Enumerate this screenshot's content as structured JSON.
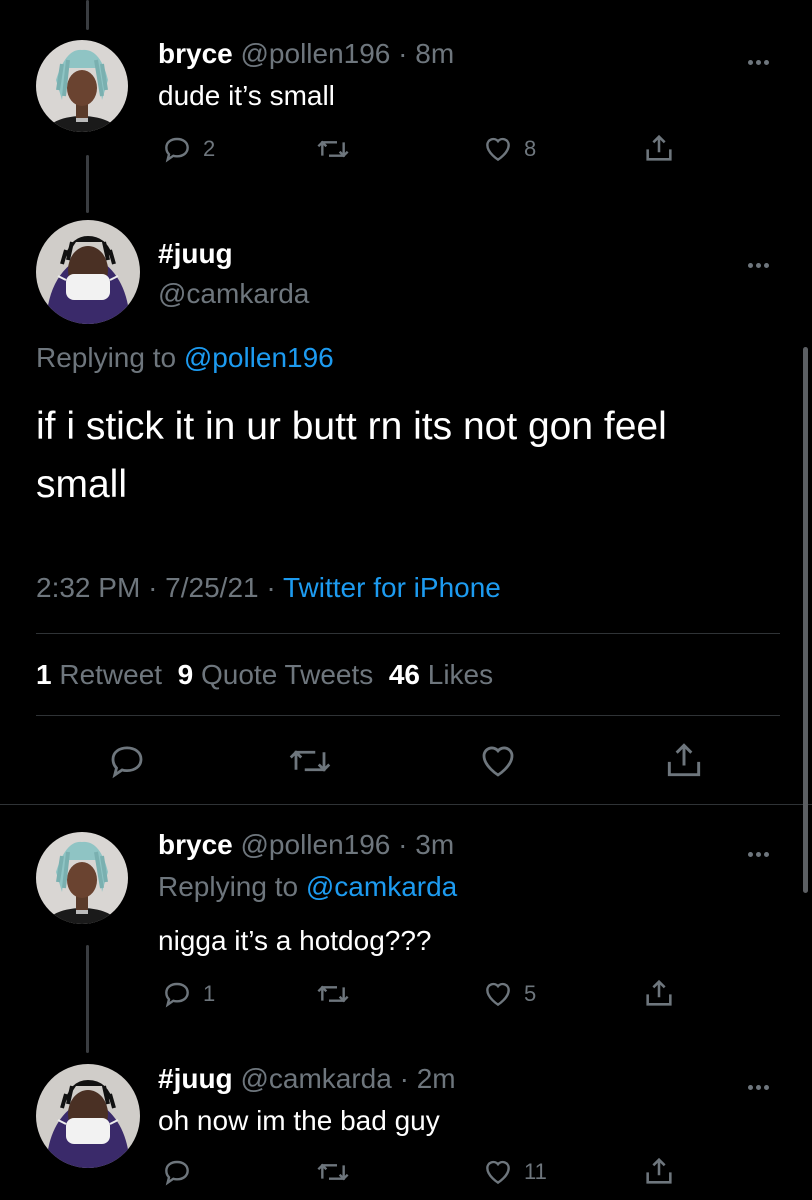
{
  "tweet_top": {
    "name": "bryce",
    "handle": "@pollen196",
    "time": "8m",
    "text": "dude it’s small",
    "replies": "2",
    "retweets": "",
    "likes": "8"
  },
  "main_tweet": {
    "name": "#juug",
    "handle": "@camkarda",
    "replying_prefix": "Replying to",
    "replying_handle": "@pollen196",
    "text_line1": "if i stick it in ur butt rn its not gon feel",
    "text_line2": "small",
    "time": "2:32 PM",
    "date": "7/25/21",
    "source": "Twitter for iPhone",
    "retweets_count": "1",
    "retweets_label": "Retweet",
    "quotes_count": "9",
    "quotes_label": "Quote Tweets",
    "likes_count": "46",
    "likes_label": "Likes"
  },
  "reply1": {
    "name": "bryce",
    "handle": "@pollen196",
    "time": "3m",
    "replying_prefix": "Replying to",
    "replying_handle": "@camkarda",
    "text": "nigga it’s a hotdog???",
    "replies": "1",
    "likes": "5"
  },
  "reply2": {
    "name": "#juug",
    "handle": "@camkarda",
    "time": "2m",
    "text": "oh now im the bad guy",
    "replies": "",
    "likes": "11"
  },
  "separator": "·",
  "colors": {
    "background": "#000000",
    "accent": "#1d9bf0",
    "muted": "#6e767d",
    "divider": "#2f3336"
  }
}
